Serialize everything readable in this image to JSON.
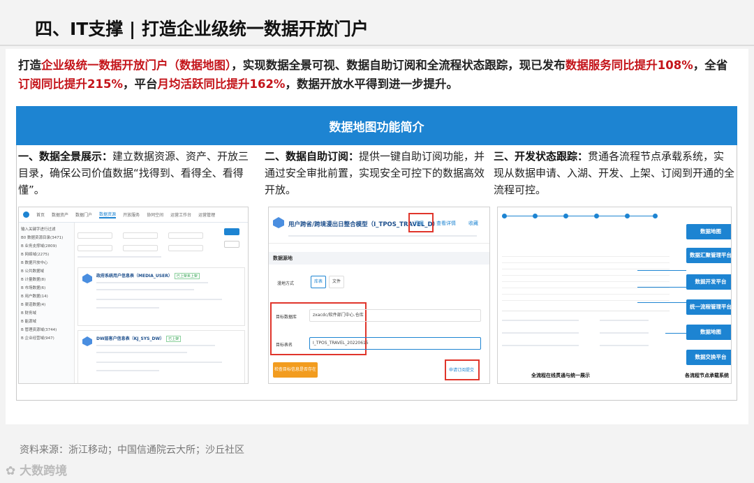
{
  "title": "四、IT支撑 | 打造企业级统一数据开放门户",
  "intro": {
    "p1": "打造",
    "r1": "企业级统一数据开放门户（数据地图）",
    "p2": "，实现数据全景可视、数据自助订阅和全流程状态跟踪，现已发布",
    "r2": "数据服务同比提升108%",
    "p3": "，全省",
    "r3": "订阅同比提升215%",
    "p4": "，平台",
    "r4": "月均活跃同比提升162%",
    "p5": "，数据开放水平得到进一步提升。"
  },
  "banner": "数据地图功能简介",
  "columns": [
    {
      "head": "一、数据全景展示：",
      "body": "建立数据资源、资产、开放三目录，确保公司价值数据“找得到、看得全、看得懂”。"
    },
    {
      "head": "二、数据自助订阅：",
      "body": "提供一键自助订阅功能，并通过安全审批前置，实现安全可控下的数据高效开放。"
    },
    {
      "head": "三、开发状态跟踪：",
      "body": "贯通各流程节点承载系统，实现从数据申请、入湖、开发、上架、订阅到开通的全流程可控。"
    }
  ],
  "shot1": {
    "nav": [
      "首页",
      "数据资产",
      "数据门户",
      "数据资源",
      "开放服务",
      "协同空间",
      "运营工作台",
      "运营管理"
    ],
    "side": [
      "输入关键字进行过滤",
      "B0 数据资源目录(3471)",
      "B 业务支撑域(2809)",
      "B 网络域(2275)",
      "B 数据开放中心",
      "B 公共数据域",
      "B 计量数据(8)",
      "B 市场数据(6)",
      "B 用户数据(14)",
      "B 渠道数据(4)",
      "B 财务域",
      "B 能源域",
      "B 管理资源域(3744)",
      "B 企业经营域(947)"
    ],
    "card1_title": "政府系统用户信息表（MEDIA_USER）",
    "card1_tag": "已上架未上架",
    "card2_title": "DW层客户信息表（KJ_SYS_DW）",
    "card2_tag": "已上架"
  },
  "shot2": {
    "title": "用户跨省/跨境漫出日整合模型（I_TPOS_TRAVEL_D）",
    "subscribe": "订阅",
    "detail": "查看详情",
    "fav": "收藏",
    "section": "数据源地",
    "label_mode": "漫地方式",
    "mode_a": "库表",
    "mode_b": "文件",
    "label_target": "目标数据库",
    "target_value": "zxacdc/软件部门中心.仓库",
    "label_table": "目标表名",
    "table_value": "I_TPOS_TRAVEL_20220615",
    "btn_check": "检查目标信息是否存在",
    "btn_submit": "申请订阅提交"
  },
  "shot3": {
    "buttons": [
      "数据地图",
      "数据汇聚管理平台",
      "数据开发平台",
      "统一流程管理平台",
      "数据地图",
      "数据交换平台"
    ],
    "caption_left": "全流程在线贯通与统一展示",
    "caption_right": "各流程节点承载系统"
  },
  "source": "资料来源：浙江移动；中国信通院云大所；沙丘社区",
  "logo": "大数跨境"
}
